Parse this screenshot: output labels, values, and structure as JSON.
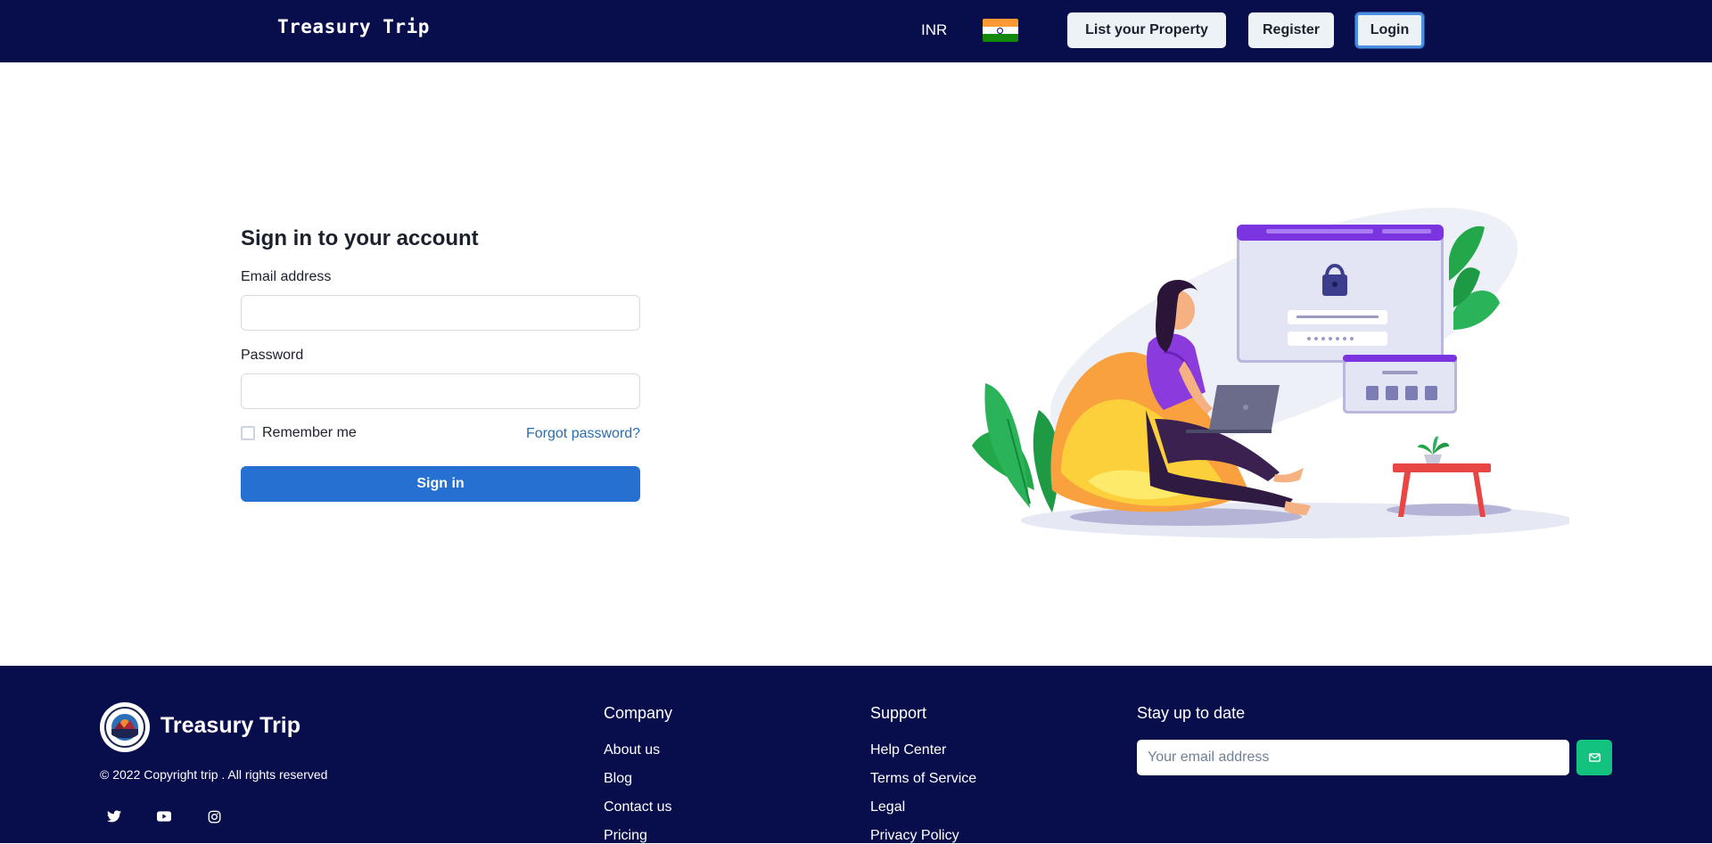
{
  "header": {
    "brand": "Treasury Trip",
    "currency": "INR",
    "flag_icon": "india-flag-icon",
    "buttons": {
      "list_property": "List your Property",
      "register": "Register",
      "login": "Login"
    }
  },
  "form": {
    "title": "Sign in to your account",
    "email_label": "Email address",
    "email_value": "",
    "password_label": "Password",
    "password_value": "",
    "remember_label": "Remember me",
    "remember_checked": false,
    "forgot_label": "Forgot password?",
    "submit_label": "Sign in"
  },
  "illustration": {
    "icon": "laptop-login-illustration"
  },
  "footer": {
    "brand": "Treasury Trip",
    "copyright": "© 2022 Copyright trip . All rights reserved",
    "social": [
      "twitter-icon",
      "youtube-icon",
      "instagram-icon"
    ],
    "company": {
      "heading": "Company",
      "links": [
        "About us",
        "Blog",
        "Contact us",
        "Pricing"
      ]
    },
    "support": {
      "heading": "Support",
      "links": [
        "Help Center",
        "Terms of Service",
        "Legal",
        "Privacy Policy"
      ]
    },
    "newsletter": {
      "heading": "Stay up to date",
      "placeholder": "Your email address",
      "submit_icon": "mail-icon"
    }
  },
  "colors": {
    "navy": "#080d4c",
    "primary": "#2670d2",
    "link": "#2b6cb0",
    "accent_green": "#13c27e"
  }
}
